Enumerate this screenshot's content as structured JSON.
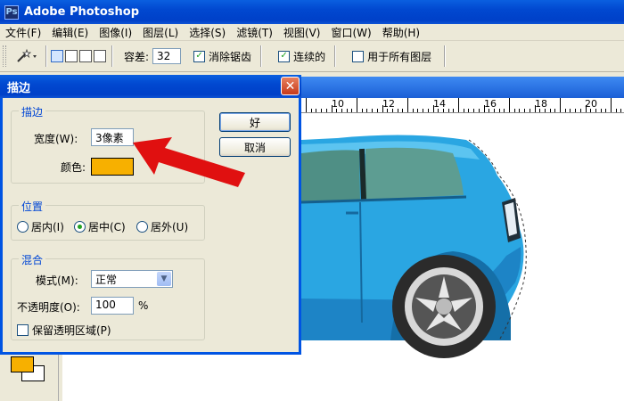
{
  "window": {
    "title": "Adobe Photoshop",
    "app_icon_letter": "Ps"
  },
  "menu": [
    "文件(F)",
    "编辑(E)",
    "图像(I)",
    "图层(L)",
    "选择(S)",
    "滤镜(T)",
    "视图(V)",
    "窗口(W)",
    "帮助(H)"
  ],
  "options": {
    "tool_icon": "magic-wand-icon",
    "tolerance_label": "容差:",
    "tolerance_value": "32",
    "antialias_label": "消除锯齿",
    "antialias_checked": true,
    "contiguous_label": "连续的",
    "contiguous_checked": true,
    "all_layers_label": "用于所有图层",
    "all_layers_checked": false
  },
  "ruler": {
    "labels": [
      "10",
      "12",
      "14",
      "16",
      "18",
      "20"
    ]
  },
  "dialog": {
    "title": "描边",
    "close_glyph": "✕",
    "stroke_group": {
      "legend": "描边",
      "width_label": "宽度(W):",
      "width_value": "3像素",
      "color_label": "颜色:",
      "color_value": "#f7b000"
    },
    "ok_label": "好",
    "cancel_label": "取消",
    "position_group": {
      "legend": "位置",
      "inside_label": "居内(I)",
      "center_label": "居中(C)",
      "outside_label": "居外(U)",
      "selected": "center"
    },
    "blend_group": {
      "legend": "混合",
      "mode_label": "模式(M):",
      "mode_value": "正常",
      "opacity_label": "不透明度(O):",
      "opacity_value": "100",
      "opacity_unit": "%",
      "preserve_label": "保留透明区域(P)",
      "preserve_checked": false
    }
  },
  "toolbox": {
    "foreground_color": "#f7b000",
    "background_color": "#ffffff"
  },
  "car": {
    "body_color": "#29a3e0",
    "window_color": "#5a9a8f"
  },
  "annotation": {
    "arrow_color": "#e01010"
  }
}
